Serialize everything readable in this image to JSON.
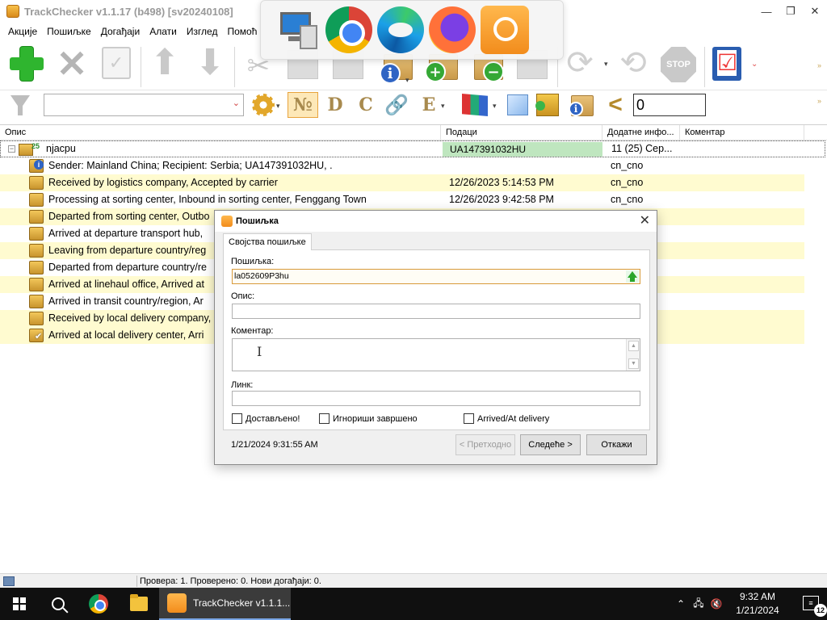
{
  "window": {
    "title": "TrackChecker v1.1.17 (b498) [sv20240108]",
    "controls": {
      "minimize": "—",
      "restore": "❐",
      "close": "✕"
    }
  },
  "menu": {
    "items": [
      "Акције",
      "Пошиљке",
      "Догађаји",
      "Алати",
      "Изглед",
      "Помоћ"
    ]
  },
  "toolbar1": {
    "stop_label": "STOP"
  },
  "toolbar2": {
    "letters": [
      "№",
      "D",
      "C",
      "E"
    ],
    "number_value": "0"
  },
  "grid": {
    "columns": [
      "Опис",
      "Подаци",
      "Додатне инфо...",
      "Коментар"
    ],
    "parent": {
      "name": "njacpu",
      "count": "25",
      "tracking": "UA147391032HU",
      "extra": "11 (25) Сер..."
    },
    "rows": [
      {
        "desc": "Sender: Mainland China; Recipient: Serbia; UA147391032HU, .",
        "date": "",
        "extra": "cn_cno",
        "alt": false,
        "icon": "info"
      },
      {
        "desc": "Received by logistics company, Accepted by carrier",
        "date": "12/26/2023 5:14:53 PM",
        "extra": "cn_cno",
        "alt": true,
        "icon": "box"
      },
      {
        "desc": "Processing at sorting center, Inbound in sorting center, Fenggang Town",
        "date": "12/26/2023 9:42:58 PM",
        "extra": "cn_cno",
        "alt": false,
        "icon": "box"
      },
      {
        "desc": "Departed from sorting center, Outbo",
        "date": "",
        "extra": "",
        "alt": true,
        "icon": "box"
      },
      {
        "desc": "Arrived at departure transport hub,",
        "date": "",
        "extra": "",
        "alt": false,
        "icon": "box"
      },
      {
        "desc": "Leaving from departure country/reg",
        "date": "",
        "extra": "",
        "alt": true,
        "icon": "box"
      },
      {
        "desc": "Departed from departure country/re",
        "date": "",
        "extra": "",
        "alt": false,
        "icon": "box"
      },
      {
        "desc": "Arrived at linehaul office, Arrived at",
        "date": "",
        "extra": "",
        "alt": true,
        "icon": "box"
      },
      {
        "desc": "Arrived in transit country/region, Ar",
        "date": "",
        "extra": "",
        "alt": false,
        "icon": "box"
      },
      {
        "desc": "Received by local delivery company,",
        "date": "",
        "extra": "",
        "alt": true,
        "icon": "box"
      },
      {
        "desc": "Arrived at local delivery center, Arri",
        "date": "",
        "extra": "",
        "alt": true,
        "icon": "check"
      }
    ]
  },
  "dialog": {
    "title": "Пошиљка",
    "tab": "Својства пошиљке",
    "fields": {
      "shipment_label": "Пошиљка:",
      "shipment_value": "la052609P3hu",
      "description_label": "Опис:",
      "description_value": "",
      "comment_label": "Коментар:",
      "comment_value": "",
      "link_label": "Линк:",
      "link_value": ""
    },
    "checkboxes": {
      "delivered": "Достављено!",
      "ignore_completed": "Игнориши завршено",
      "arrived_delivery": "Arrived/At delivery"
    },
    "timestamp": "1/21/2024 9:31:55 AM",
    "buttons": {
      "prev": "< Претходно",
      "next": "Следеће >",
      "cancel": "Откажи"
    }
  },
  "statusbar": {
    "text": "Провера: 1. Проверено: 0. Нови догађаји: 0."
  },
  "taskbar": {
    "active_app": "TrackChecker v1.1.1...",
    "time": "9:32 AM",
    "date": "1/21/2024",
    "notifications": "12"
  }
}
